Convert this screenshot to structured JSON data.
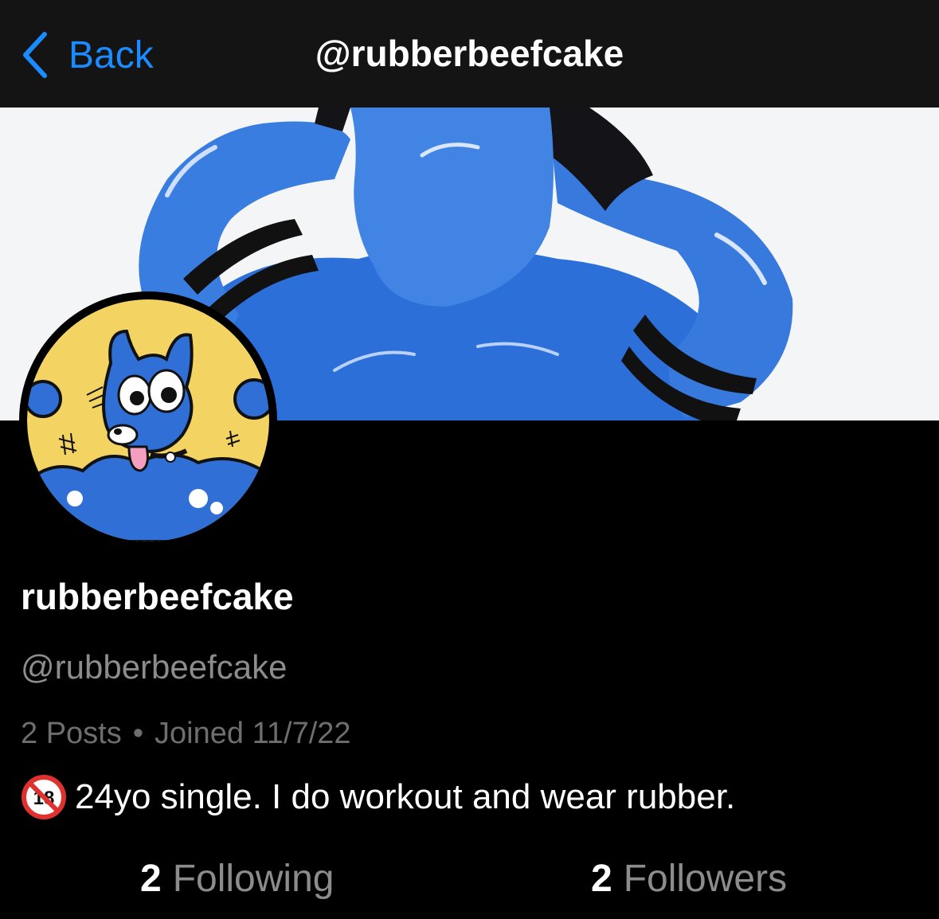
{
  "nav": {
    "back_label": "Back",
    "title": "@rubberbeefcake"
  },
  "profile": {
    "display_name": "rubberbeefcake",
    "handle": "@rubberbeefcake",
    "posts": "2 Posts",
    "separator": "•",
    "joined": "Joined 11/7/22",
    "bio": "24yo single. I do workout and wear rubber.",
    "bio_icon": "no-under-18-icon"
  },
  "stats": {
    "following_count": "2",
    "following_label": "Following",
    "followers_count": "2",
    "followers_label": "Followers"
  },
  "colors": {
    "accent": "#1a8cff",
    "nav_bg": "#141414",
    "latex_blue": "#2d6fd8",
    "avatar_bg": "#f3d463"
  }
}
